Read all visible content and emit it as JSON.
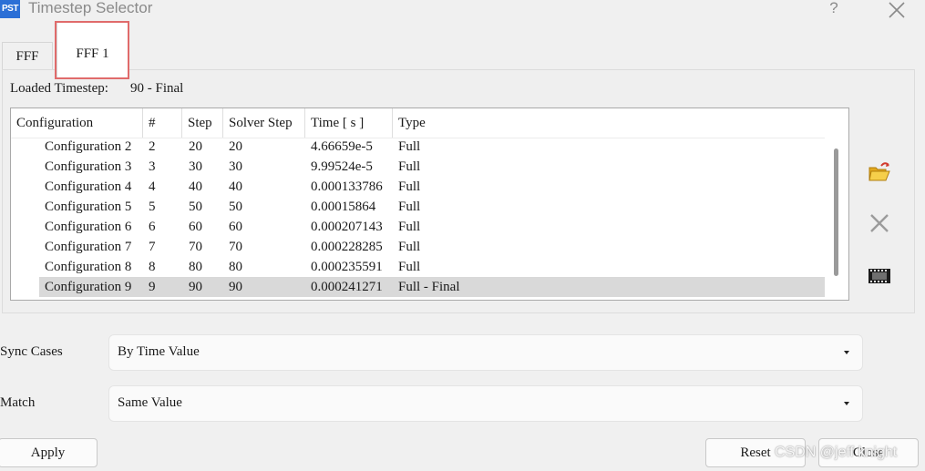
{
  "window": {
    "icon_text": "PST",
    "title": "Timestep Selector",
    "help_label": "?"
  },
  "tabs": [
    {
      "label": "FFF"
    },
    {
      "label": "FFF 1"
    }
  ],
  "loaded": {
    "label": "Loaded Timestep:",
    "value": "90 - Final"
  },
  "table": {
    "columns": [
      "Configuration",
      "#",
      "Step",
      "Solver Step",
      "Time [ s ]",
      "Type"
    ],
    "rows": [
      [
        "Configuration 2",
        "2",
        "20",
        "20",
        "4.66659e-5",
        "Full"
      ],
      [
        "Configuration 3",
        "3",
        "30",
        "30",
        "9.99524e-5",
        "Full"
      ],
      [
        "Configuration 4",
        "4",
        "40",
        "40",
        "0.000133786",
        "Full"
      ],
      [
        "Configuration 5",
        "5",
        "50",
        "50",
        "0.00015864",
        "Full"
      ],
      [
        "Configuration 6",
        "6",
        "60",
        "60",
        "0.000207143",
        "Full"
      ],
      [
        "Configuration 7",
        "7",
        "70",
        "70",
        "0.000228285",
        "Full"
      ],
      [
        "Configuration 8",
        "8",
        "80",
        "80",
        "0.000235591",
        "Full"
      ],
      [
        "Configuration 9",
        "9",
        "90",
        "90",
        "0.000241271",
        "Full - Final"
      ]
    ],
    "selected_row": "Configuration 9"
  },
  "side_icons": [
    "open-folder-icon",
    "delete-x-icon",
    "film-strip-icon"
  ],
  "sync": {
    "label": "Sync Cases",
    "value": "By Time Value"
  },
  "match": {
    "label": "Match",
    "value": "Same Value"
  },
  "buttons": {
    "apply": "Apply",
    "reset": "Reset",
    "close": "Close"
  },
  "watermark": "CSDN @jeff knight",
  "colors": {
    "selected_row": "#d9d9d9",
    "tab_highlight": "#e06b6b",
    "app_icon": "#2b6fd6"
  }
}
